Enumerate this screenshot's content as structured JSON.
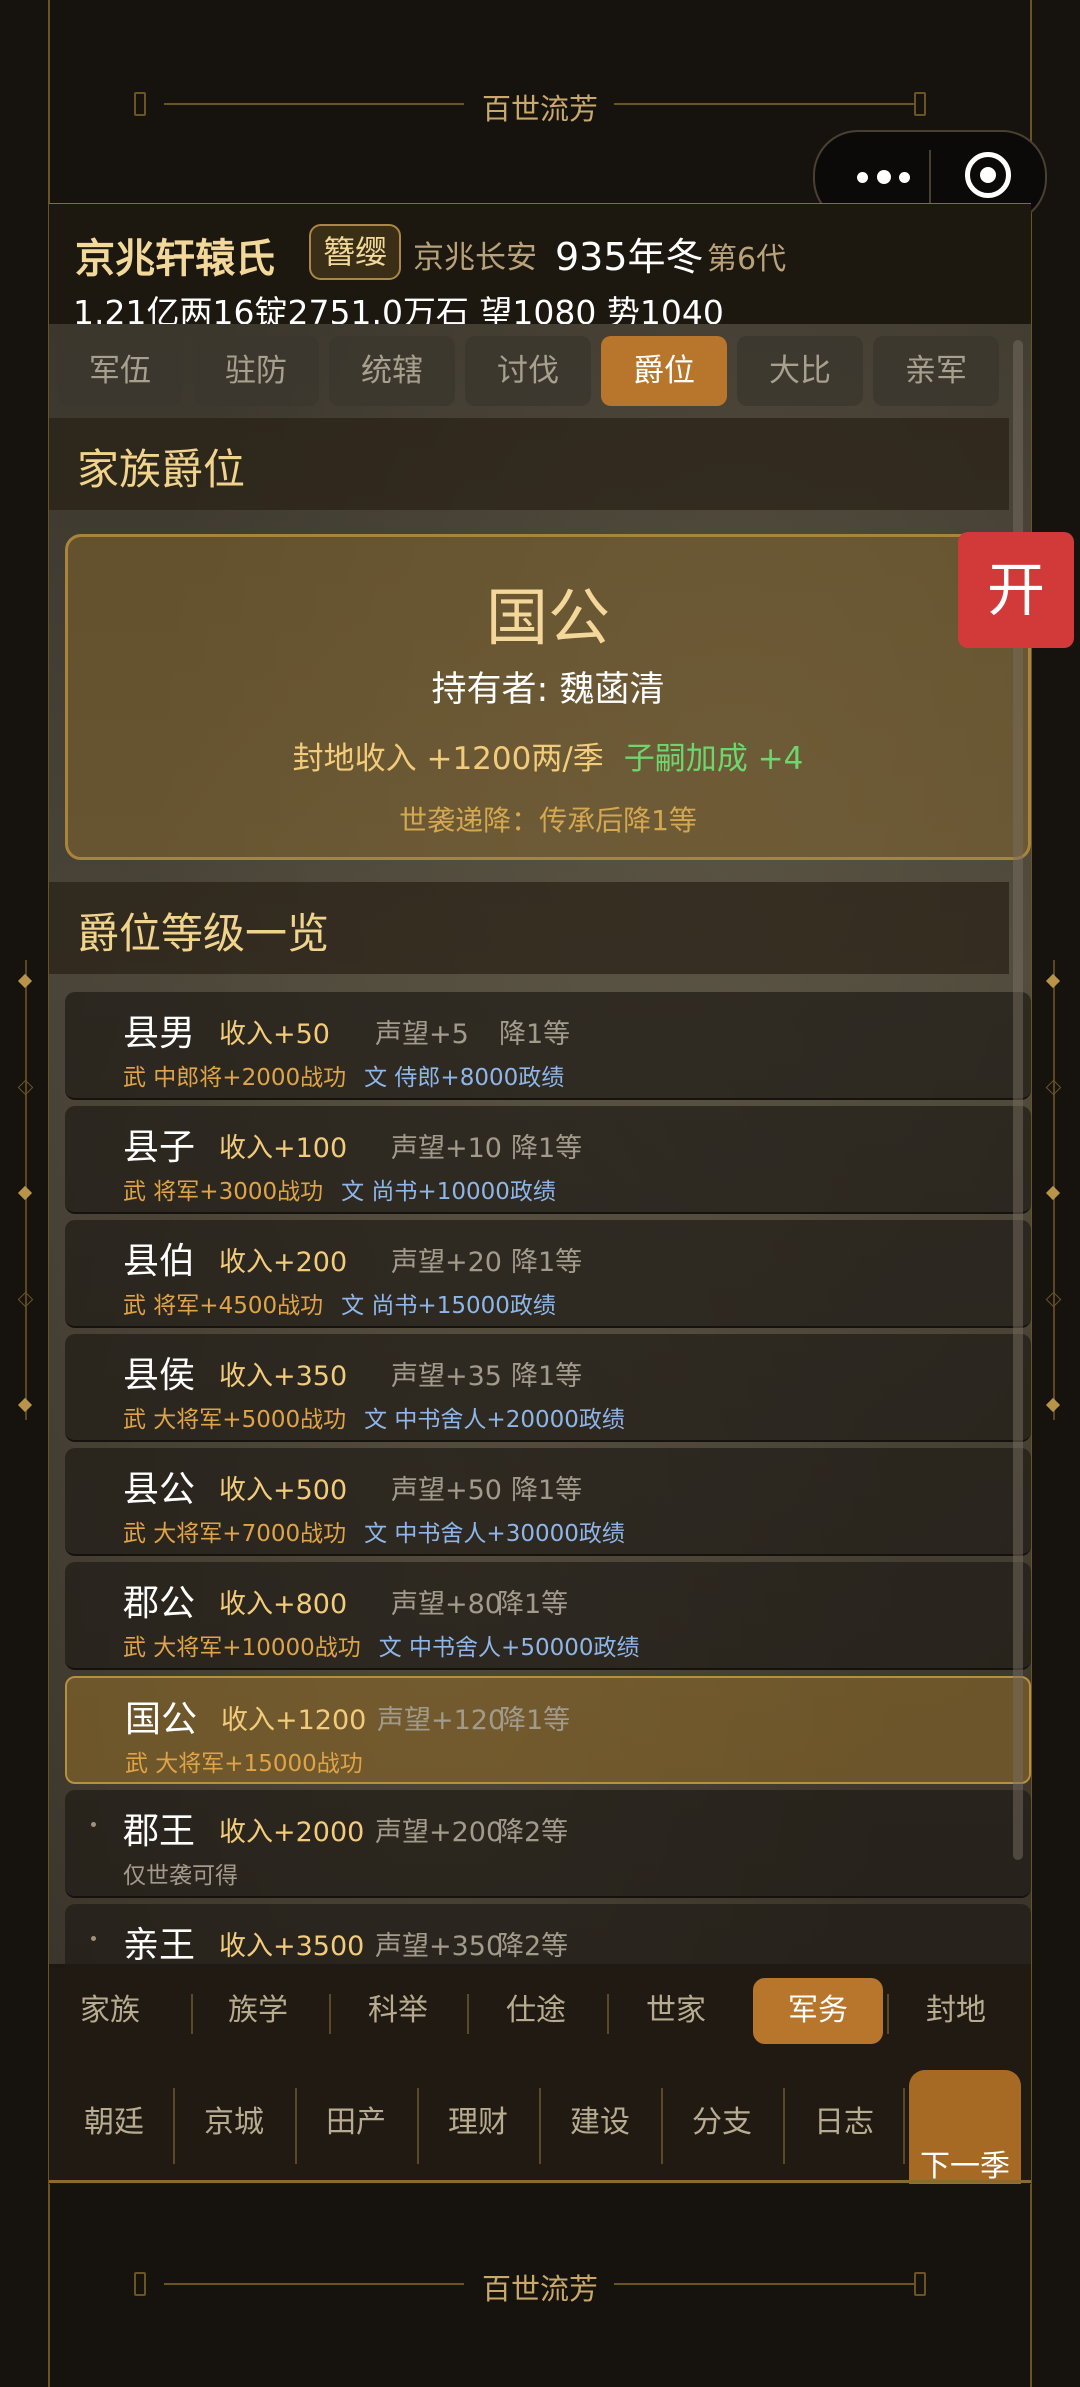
{
  "banner": {
    "title": "百世流芳"
  },
  "header": {
    "family_name": "京兆轩辕氏",
    "badge": "簪缨",
    "location": "京兆长安",
    "date": "935年冬",
    "generation": "第6代",
    "wealth": "1.21亿两16锭2751.0万石  望1080 势1040"
  },
  "tabs": [
    {
      "label": "军伍",
      "active": false
    },
    {
      "label": "驻防",
      "active": false
    },
    {
      "label": "统辖",
      "active": false
    },
    {
      "label": "讨伐",
      "active": false
    },
    {
      "label": "爵位",
      "active": true
    },
    {
      "label": "大比",
      "active": false
    },
    {
      "label": "亲军",
      "active": false
    }
  ],
  "family_title": {
    "heading": "家族爵位",
    "rank": "国公",
    "holder": "持有者: 魏菡清",
    "income": "封地收入 +1200两/季",
    "heir_bonus": "子嗣加成 +4",
    "decay": "世袭递降：传承后降1等"
  },
  "open_button": "开",
  "list_heading": "爵位等级一览",
  "ranks": [
    {
      "name": "县男",
      "income": "收入+50",
      "prestige": "声望+5",
      "decay": "降1等",
      "wu": "武 中郎将+2000战功",
      "wen": "文 侍郎+8000政绩"
    },
    {
      "name": "县子",
      "income": "收入+100",
      "prestige": "声望+10",
      "decay": "降1等",
      "wu": "武 将军+3000战功",
      "wen": "文 尚书+10000政绩"
    },
    {
      "name": "县伯",
      "income": "收入+200",
      "prestige": "声望+20",
      "decay": "降1等",
      "wu": "武 将军+4500战功",
      "wen": "文 尚书+15000政绩"
    },
    {
      "name": "县侯",
      "income": "收入+350",
      "prestige": "声望+35",
      "decay": "降1等",
      "wu": "武 大将军+5000战功",
      "wen": "文 中书舍人+20000政绩"
    },
    {
      "name": "县公",
      "income": "收入+500",
      "prestige": "声望+50",
      "decay": "降1等",
      "wu": "武 大将军+7000战功",
      "wen": "文 中书舍人+30000政绩"
    },
    {
      "name": "郡公",
      "income": "收入+800",
      "prestige": "声望+80",
      "decay": "降1等",
      "wu": "武 大将军+10000战功",
      "wen": "文 中书舍人+50000政绩"
    },
    {
      "name": "国公",
      "income": "收入+1200",
      "prestige": "声望+120",
      "decay": "降1等",
      "wu": "武 大将军+15000战功",
      "wen": ""
    },
    {
      "name": "郡王",
      "income": "收入+2000",
      "prestige": "声望+200",
      "decay": "降2等",
      "only": "仅世袭可得"
    },
    {
      "name": "亲王",
      "income": "收入+3500",
      "prestige": "声望+350",
      "decay": "降2等",
      "only": ""
    }
  ],
  "nav_primary": [
    {
      "label": "家族",
      "active": false
    },
    {
      "label": "族学",
      "active": false
    },
    {
      "label": "科举",
      "active": false
    },
    {
      "label": "仕途",
      "active": false
    },
    {
      "label": "世家",
      "active": false
    },
    {
      "label": "军务",
      "active": true
    },
    {
      "label": "封地",
      "active": false
    }
  ],
  "nav_secondary": [
    "朝廷",
    "京城",
    "田产",
    "理财",
    "建设",
    "分支",
    "日志"
  ],
  "next_season": "下一季"
}
